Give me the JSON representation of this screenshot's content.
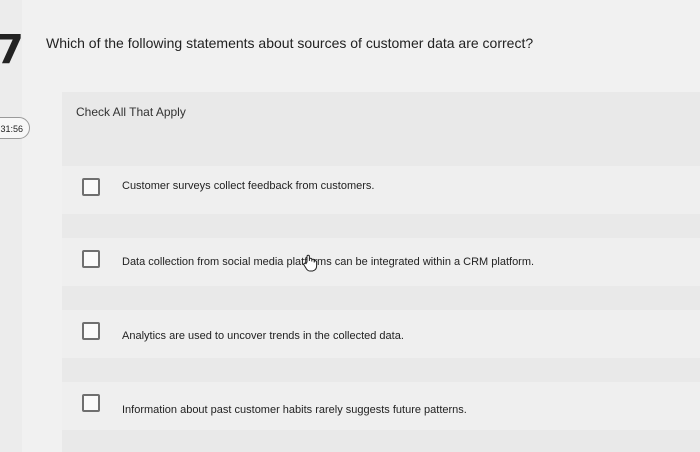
{
  "question_number": "7",
  "timer": "31:56",
  "question": "Which of the following statements about sources of customer data are correct?",
  "instruction": "Check All That Apply",
  "options": [
    {
      "label": "Customer surveys collect feedback from customers.",
      "checked": false
    },
    {
      "label": "Data collection from social media platforms can be integrated within a CRM platform.",
      "checked": false
    },
    {
      "label": "Analytics are used to uncover trends in the collected data.",
      "checked": false
    },
    {
      "label": "Information about past customer habits rarely suggests future patterns.",
      "checked": false
    }
  ]
}
